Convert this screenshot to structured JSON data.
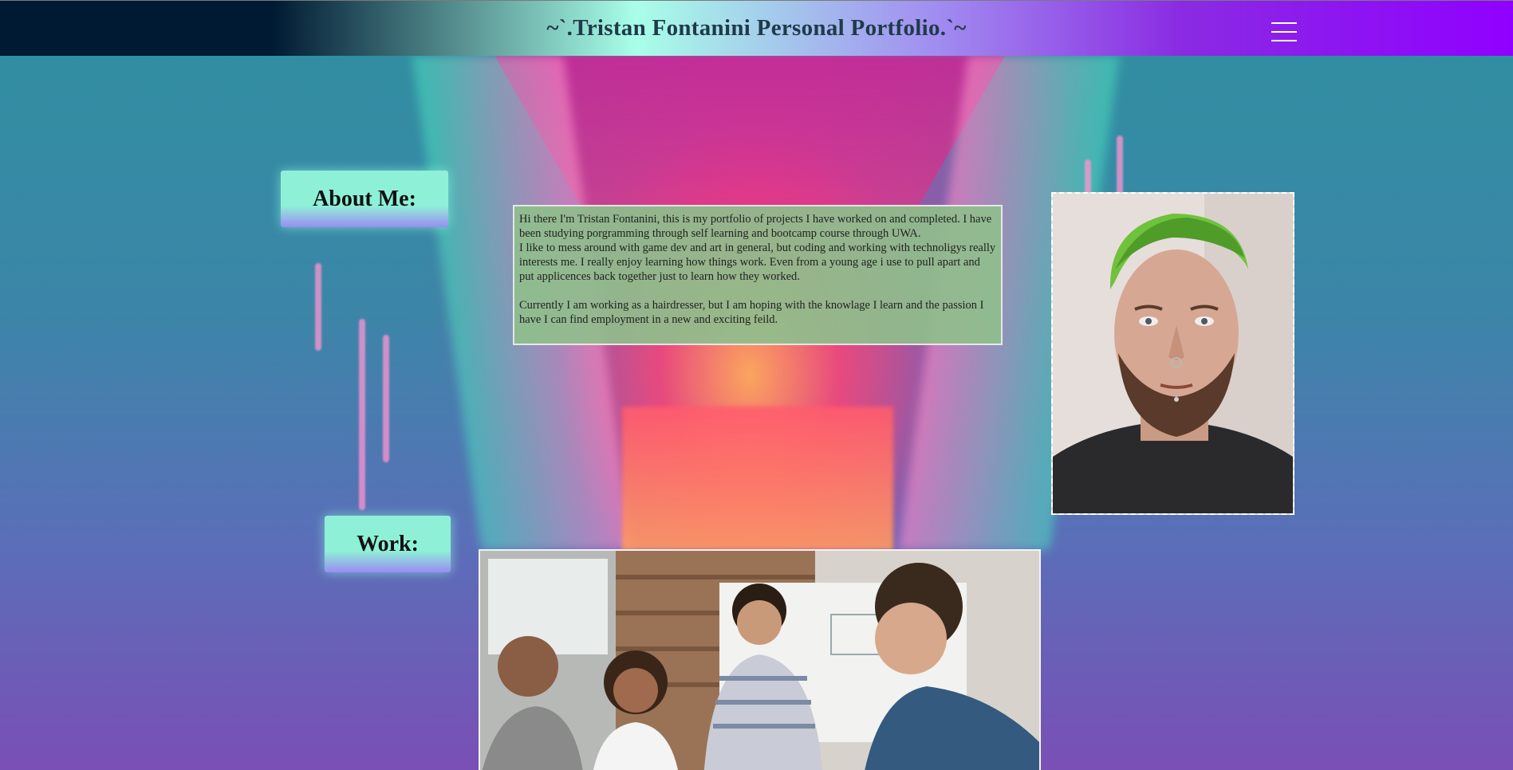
{
  "header": {
    "title": "~`.Tristan Fontanini Personal Portfolio.`~",
    "menu_icon": "hamburger-menu-icon"
  },
  "about": {
    "label": "About Me:",
    "paragraph_1": "Hi there I'm Tristan Fontanini, this is my portfolio of projects I have worked on and completed. I have been studying porgramming through self learning and bootcamp course through UWA.",
    "paragraph_2": "I like to mess around with game dev and art in general, but coding and working with technoligys really interests me. I really enjoy learning how things work. Even from a young age i use to pull apart and put applicences back together just to learn how they worked.",
    "paragraph_3": "Currently I am working as a hairdresser, but I am hoping with the knowlage I learn and the passion I have I can find employment in a new and exciting feild."
  },
  "work": {
    "label": "Work:"
  },
  "colors": {
    "label_mint": "#8ff0d8",
    "label_lavender": "#9a8cf2",
    "about_box": "#8fbe8c",
    "nav_dark": "#001a33",
    "nav_purple": "#9000ff"
  }
}
